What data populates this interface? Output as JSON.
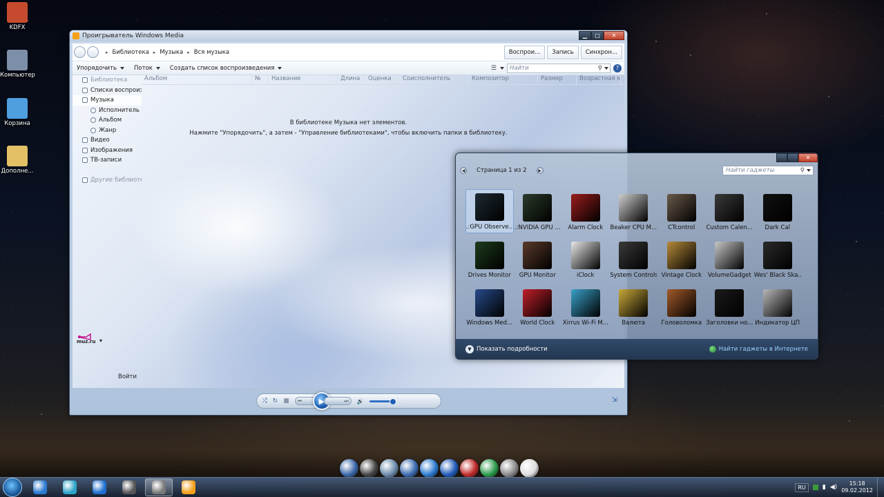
{
  "desktop": {
    "icons": [
      {
        "label": "KDFX",
        "color": "#c64b2e"
      },
      {
        "label": "Компьютер",
        "color": "#7d8ea8"
      },
      {
        "label": "Корзина",
        "color": "#4f9fe0"
      },
      {
        "label": "Дополне...",
        "color": "#e3c066"
      }
    ]
  },
  "wmp": {
    "title": "Проигрыватель Windows Media",
    "window_buttons": {
      "minimize": "▁",
      "maximize": "□",
      "close": "✕"
    },
    "breadcrumb": [
      "Библиотека",
      "Музыка",
      "Вся музыка"
    ],
    "tabs": [
      "Воспрои...",
      "Запись",
      "Синхрон..."
    ],
    "toolbar": {
      "organize": "Упорядочить",
      "stream": "Поток",
      "create_playlist": "Создать список воспроизведения",
      "search_placeholder": "Найти",
      "search_icon": "⚲",
      "help": "?"
    },
    "tree": [
      {
        "label": "Библиотека",
        "style": "grey"
      },
      {
        "label": "Списки воспроизведения",
        "style": ""
      },
      {
        "label": "Музыка",
        "style": "sel"
      },
      {
        "label": "Исполнитель",
        "style": "sub"
      },
      {
        "label": "Альбом",
        "style": "sub"
      },
      {
        "label": "Жанр",
        "style": "sub"
      },
      {
        "label": "Видео",
        "style": ""
      },
      {
        "label": "Изображения",
        "style": ""
      },
      {
        "label": "ТВ-записи",
        "style": ""
      },
      {
        "label": "",
        "style": "gap"
      },
      {
        "label": "Другие библиотеки",
        "style": "grey"
      }
    ],
    "columns": [
      "Альбом",
      "№",
      "Название",
      "Длина",
      "Оценка",
      "Соисполнитель",
      "Композитор",
      "Размер",
      "Возрастная категория"
    ],
    "empty_line1": "В библиотеке Музыка нет элементов.",
    "empty_line2": "Нажмите \"Упорядочить\", а затем - \"Управление библиотеками\", чтобы включить папки в библиотеку.",
    "store_label": "muz.ru",
    "store_arrow": "▾",
    "login": "Войти",
    "controls": {
      "shuffle": "⤮",
      "repeat": "↻",
      "stop": "■",
      "prev": "⏮",
      "play": "▶",
      "next": "⏭",
      "mute": "🔊",
      "volume": 0.8,
      "switch_mode": "⇲"
    }
  },
  "gallery": {
    "page": "Страница 1 из 2",
    "prev": "◀",
    "next": "▶",
    "search_placeholder": "Найти гаджеты",
    "search_icon": "⚲",
    "close": "✕",
    "gadgets": [
      {
        "label": ".:GPU Observe...",
        "color": "#1d2a33",
        "selected": true
      },
      {
        "label": ".:NVIDIA GPU ...",
        "color": "#2b3b2b",
        "selected": false
      },
      {
        "label": "Alarm Clock",
        "color": "#9b1d1d",
        "selected": false
      },
      {
        "label": "Beaker CPU M...",
        "color": "#cfcfcf",
        "selected": false
      },
      {
        "label": "CTcontrol",
        "color": "#6a5a4a",
        "selected": false
      },
      {
        "label": "Custom Calen...",
        "color": "#3a3a3a",
        "selected": false
      },
      {
        "label": "Dark Cal",
        "color": "#101010",
        "selected": false
      },
      {
        "label": "Drives Monitor",
        "color": "#1d3b1d",
        "selected": false
      },
      {
        "label": "GPU Monitor",
        "color": "#5a3a2a",
        "selected": false
      },
      {
        "label": "iClock",
        "color": "#e8e8e8",
        "selected": false
      },
      {
        "label": "System Controls",
        "color": "#3a3a3a",
        "selected": false
      },
      {
        "label": "Vintage Clock",
        "color": "#b58a3a",
        "selected": false
      },
      {
        "label": "VolumeGadget",
        "color": "#c8c8c8",
        "selected": false
      },
      {
        "label": "Wes' Black Ska...",
        "color": "#2a2a2a",
        "selected": false
      },
      {
        "label": "Windows Med...",
        "color": "#274b8a",
        "selected": false
      },
      {
        "label": "World Clock",
        "color": "#c0202a",
        "selected": false
      },
      {
        "label": "Xirrus Wi-Fi M...",
        "color": "#3aa0c8",
        "selected": false
      },
      {
        "label": "Валюта",
        "color": "#c9a93a",
        "selected": false
      },
      {
        "label": "Головоломка",
        "color": "#a25a2a",
        "selected": false
      },
      {
        "label": "Заголовки но...",
        "color": "#1a1a1a",
        "selected": false
      },
      {
        "label": "Индикатор ЦП",
        "color": "#b8b8b8",
        "selected": false
      }
    ],
    "show_details": "Показать подробности",
    "find_online": "Найти гаджеты в Интернете"
  },
  "dock": {
    "icons": [
      "#3a66a8",
      "#444444",
      "#6a8aaa",
      "#3a6ab0",
      "#2a7ad0",
      "#1f5ab8",
      "#c02a2a",
      "#2a9a4a",
      "#888888",
      "#dddddd"
    ]
  },
  "taskbar": {
    "pinned": [
      {
        "name": "ie-icon",
        "color": "#2a7ad0",
        "active": false
      },
      {
        "name": "app-icon",
        "color": "#2fa4c8",
        "active": false
      },
      {
        "name": "media-player-icon",
        "color": "#1f6fd0",
        "active": false
      },
      {
        "name": "game-icon",
        "color": "#555555",
        "active": false
      },
      {
        "name": "gadgets-icon",
        "color": "#7a7a7a",
        "active": true
      },
      {
        "name": "wmp-window-icon",
        "color": "#f3a01b",
        "active": false
      }
    ],
    "lang": "RU",
    "time": "15:18",
    "date": "09.02.2012"
  }
}
